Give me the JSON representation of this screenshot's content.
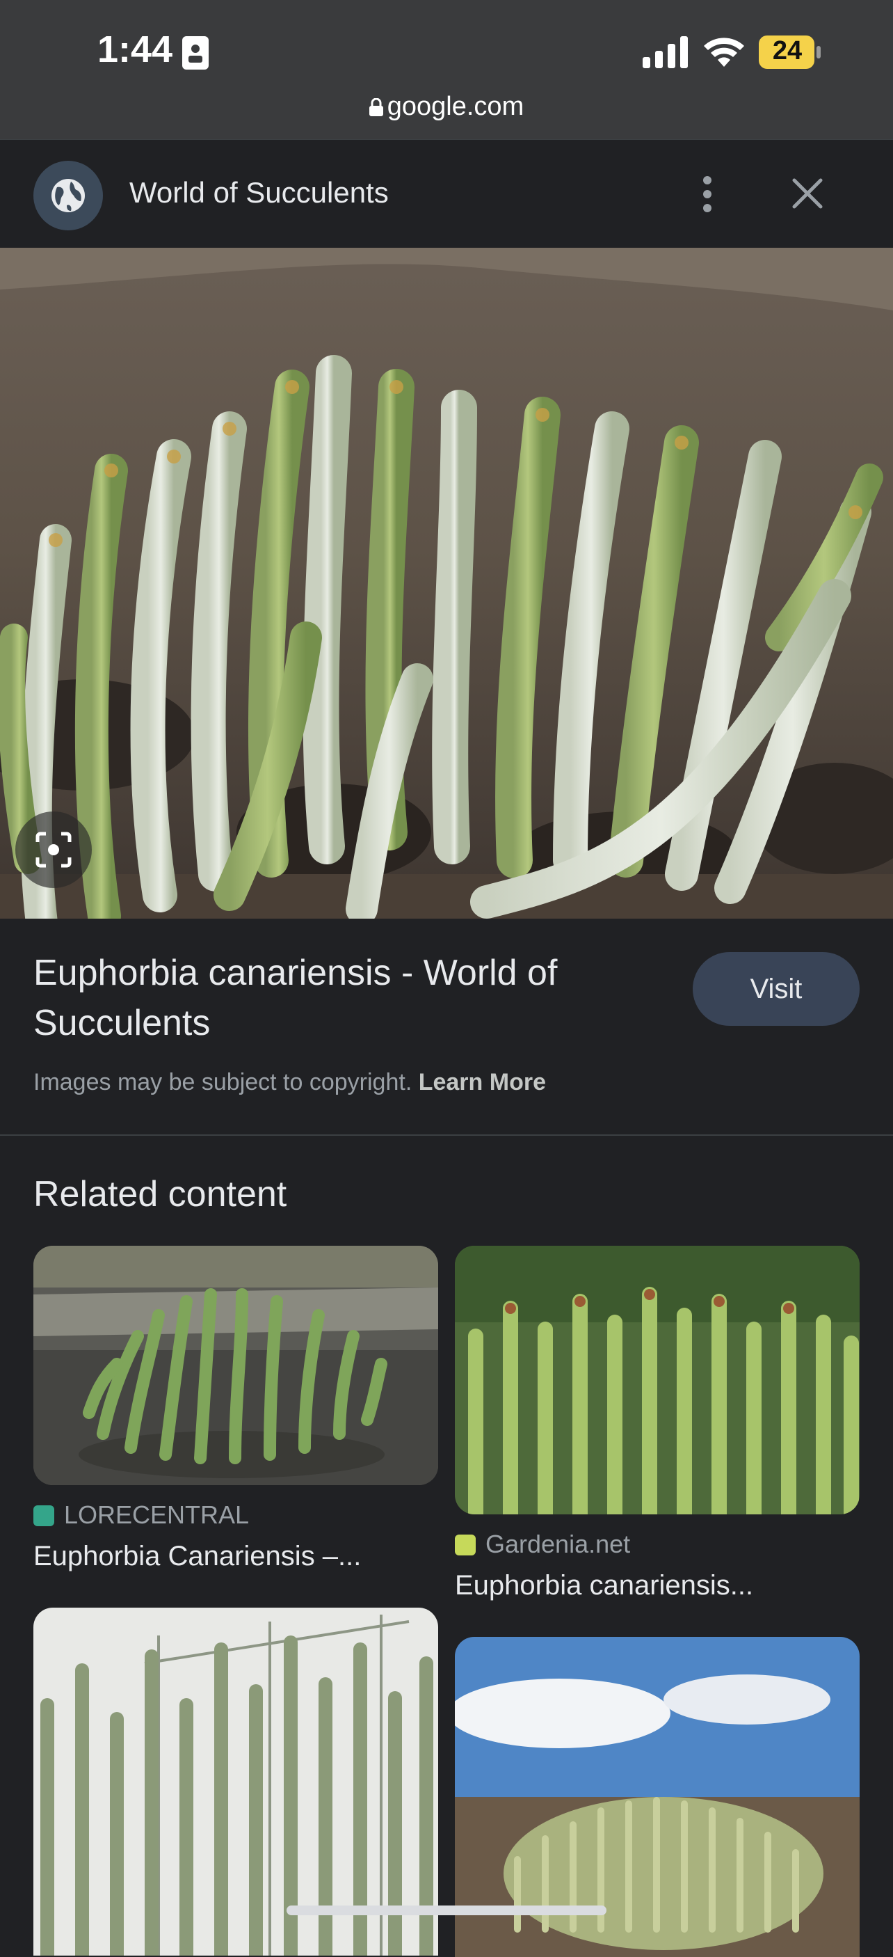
{
  "status_bar": {
    "time": "1:44",
    "battery": "24"
  },
  "browser": {
    "url": "google.com"
  },
  "header": {
    "site_title": "World of Succulents"
  },
  "result": {
    "title": "Euphorbia canariensis - World of Succulents",
    "visit_label": "Visit",
    "copyright_text": "Images may be subject to copyright.",
    "learn_more": "Learn More"
  },
  "related": {
    "heading": "Related content",
    "items": [
      {
        "source": "LORECENTRAL",
        "caption": "Euphorbia Canariensis –...",
        "source_color": "#34a58a"
      },
      {
        "source": "Gardenia.net",
        "caption": "Euphorbia canariensis...",
        "source_color": "#c6d95a"
      }
    ]
  },
  "colors": {
    "background": "#202124",
    "status_bar": "#3a3b3d",
    "visit_button": "#394457",
    "battery": "#f5d24a"
  },
  "icons": [
    "id-card-icon",
    "signal-icon",
    "wifi-icon",
    "battery-icon",
    "lock-icon",
    "globe-icon",
    "more-vert-icon",
    "close-icon",
    "lens-icon"
  ]
}
